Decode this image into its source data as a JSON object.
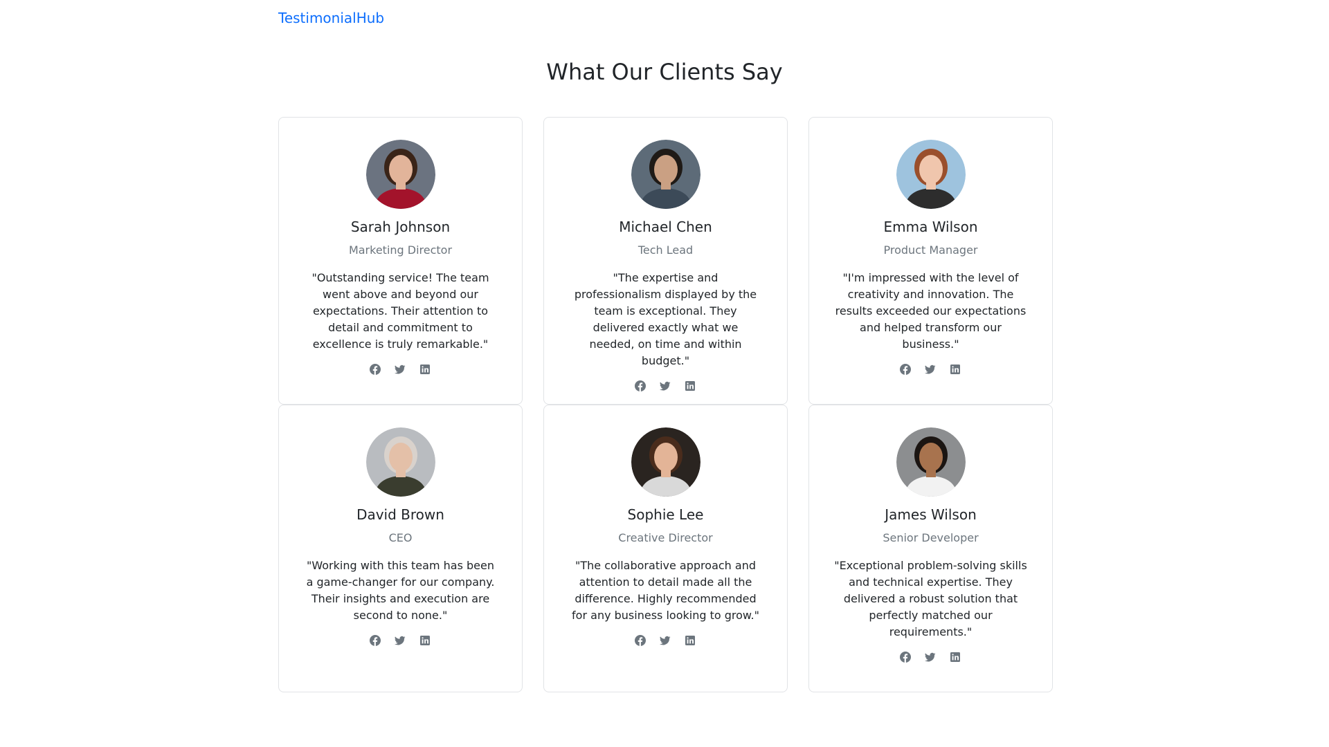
{
  "nav": {
    "brand": "TestimonialHub"
  },
  "page": {
    "heading": "What Our Clients Say"
  },
  "colors": {
    "link": "#0d6efd",
    "muted": "#6c757d",
    "border": "#e1e3e6"
  },
  "testimonials": [
    {
      "name": "Sarah Johnson",
      "role": "Marketing Director",
      "quote": "\"Outstanding service! The team went above and beyond our expectations. Their attention to detail and commitment to excellence is truly remarkable.\"",
      "avatar": {
        "bg": "#6b7380",
        "skin": "#e2b49a",
        "hair": "#3a2418",
        "shirt": "#a3132b"
      },
      "socials": [
        "facebook-icon",
        "twitter-icon",
        "linkedin-icon"
      ]
    },
    {
      "name": "Michael Chen",
      "role": "Tech Lead",
      "quote": "\"The expertise and professionalism displayed by the team is exceptional. They delivered exactly what we needed, on time and within budget.\"",
      "avatar": {
        "bg": "#5d6b78",
        "skin": "#caa083",
        "hair": "#1f1a16",
        "shirt": "#3c4a58"
      },
      "socials": [
        "facebook-icon",
        "twitter-icon",
        "linkedin-icon"
      ]
    },
    {
      "name": "Emma Wilson",
      "role": "Product Manager",
      "quote": "\"I'm impressed with the level of creativity and innovation. The results exceeded our expectations and helped transform our business.\"",
      "avatar": {
        "bg": "#9ec3de",
        "skin": "#f0c6ad",
        "hair": "#9a4f2c",
        "shirt": "#2d2d2d"
      },
      "socials": [
        "facebook-icon",
        "twitter-icon",
        "linkedin-icon"
      ]
    },
    {
      "name": "David Brown",
      "role": "CEO",
      "quote": "\"Working with this team has been a game-changer for our company. Their insights and execution are second to none.\"",
      "avatar": {
        "bg": "#b9bcc0",
        "skin": "#e4c0a8",
        "hair": "#d9d2cc",
        "shirt": "#3a3d2f"
      },
      "socials": [
        "facebook-icon",
        "twitter-icon",
        "linkedin-icon"
      ]
    },
    {
      "name": "Sophie Lee",
      "role": "Creative Director",
      "quote": "\"The collaborative approach and attention to detail made all the difference. Highly recommended for any business looking to grow.\"",
      "avatar": {
        "bg": "#2a2420",
        "skin": "#e3b497",
        "hair": "#4a2c1c",
        "shirt": "#d9d9d9"
      },
      "socials": [
        "facebook-icon",
        "twitter-icon",
        "linkedin-icon"
      ]
    },
    {
      "name": "James Wilson",
      "role": "Senior Developer",
      "quote": "\"Exceptional problem-solving skills and technical expertise. They delivered a robust solution that perfectly matched our requirements.\"",
      "avatar": {
        "bg": "#8c8e90",
        "skin": "#a8734e",
        "hair": "#1b1512",
        "shirt": "#f2f2f2"
      },
      "socials": [
        "facebook-icon",
        "twitter-icon",
        "linkedin-icon"
      ]
    }
  ]
}
